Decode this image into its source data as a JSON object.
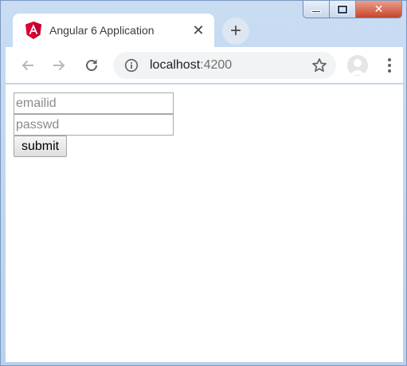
{
  "browser": {
    "tab": {
      "title": "Angular 6 Application",
      "close_glyph": "✕",
      "logo_icon": "angular-logo-icon"
    },
    "new_tab_glyph": "+",
    "address": {
      "host": "localhost",
      "port": ":4200"
    },
    "icons": {
      "back": "back-arrow-icon",
      "forward": "forward-arrow-icon",
      "reload": "reload-icon",
      "site_info": "info-icon",
      "bookmark": "star-icon",
      "profile": "avatar-icon",
      "menu": "kebab-menu-icon"
    },
    "window_controls": {
      "close_glyph": "✕"
    },
    "colors": {
      "angular_red": "#dd0031",
      "frame": "#c9dcf2",
      "close_button": "#c8452c"
    }
  },
  "form": {
    "email": {
      "placeholder": "emailid",
      "value": ""
    },
    "password": {
      "placeholder": "passwd",
      "value": ""
    },
    "submit_label": "submit"
  }
}
